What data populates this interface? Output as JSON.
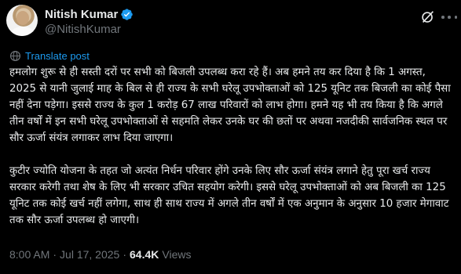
{
  "author": {
    "display_name": "Nitish Kumar",
    "handle": "@NitishKumar",
    "verified_icon": "verified-badge-icon",
    "verified_color": "#1d9bf0"
  },
  "actions": {
    "grok_icon": "grok-icon",
    "more_icon": "more-icon"
  },
  "translate": {
    "label": "Translate post",
    "icon": "translate-icon",
    "color": "#1d9bf0"
  },
  "post": {
    "paragraphs": [
      "हमलोग शुरू से ही सस्ती दरों पर सभी को बिजली उपलब्ध करा रहे हैं। अब हमने तय कर दिया है कि 1 अगस्त, 2025 से यानी जुलाई माह के बिल से ही राज्य के सभी घरेलू उपभोक्ताओं को 125 यूनिट तक बिजली का कोई पैसा नहीं देना पड़ेगा। इससे राज्य के कुल 1 करोड़ 67 लाख परिवारों को लाभ होगा। हमने यह भी तय किया है कि अगले तीन वर्षों में इन सभी घरेलू उपभोक्ताओं से सहमति लेकर उनके घर की छतों पर अथवा नजदीकी सार्वजनिक स्थल पर सौर ऊर्जा संयंत्र लगाकर लाभ दिया जाएगा।",
      "कुटीर ज्योति योजना के तहत जो अत्यंत निर्धन परिवार होंगे उनके लिए सौर ऊर्जा संयंत्र लगाने हेतु पूरा खर्च राज्य सरकार करेगी तथा शेष के लिए भी सरकार उचित सहयोग करेगी। इससे घरेलू उपभोक्ताओं को अब बिजली का 125 यूनिट तक कोई खर्च नहीं लगेगा, साथ ही साथ राज्य में अगले तीन वर्षों में एक अनुमान के अनुसार 10 हजार मेगावाट तक सौर ऊर्जा उपलब्ध हो जाएगी।"
    ]
  },
  "meta": {
    "time": "8:00 AM",
    "separator": "·",
    "date": "Jul 17, 2025",
    "views_count": "64.4K",
    "views_label": "Views"
  },
  "colors": {
    "background": "#000000",
    "text": "#e7e9ea",
    "secondary": "#71767b",
    "accent": "#1d9bf0"
  }
}
